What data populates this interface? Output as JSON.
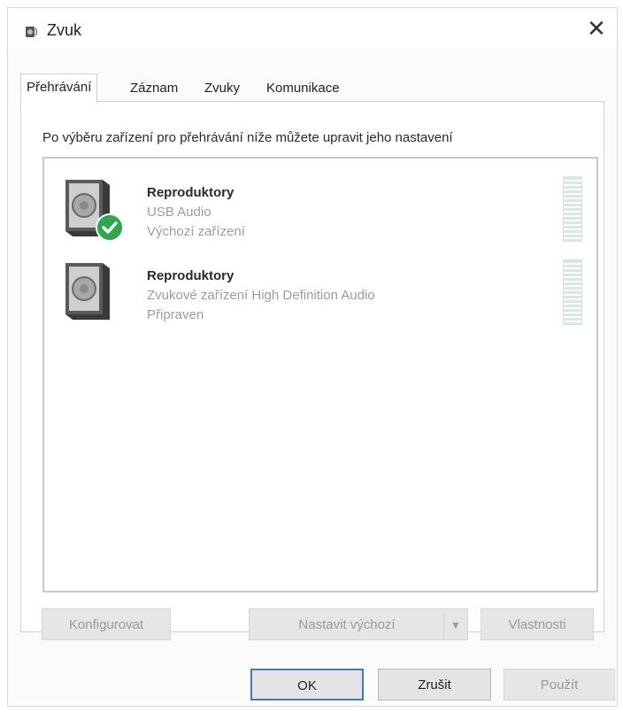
{
  "window": {
    "title": "Zvuk"
  },
  "tabs": [
    {
      "label": "Přehrávání",
      "active": true
    },
    {
      "label": "Záznam",
      "active": false
    },
    {
      "label": "Zvuky",
      "active": false
    },
    {
      "label": "Komunikace",
      "active": false
    }
  ],
  "panel": {
    "instruction": "Po výběru zařízení pro přehrávání níže můžete upravit jeho nastavení",
    "devices": [
      {
        "name": "Reproduktory",
        "description": "USB Audio",
        "status": "Výchozí zařízení",
        "is_default": true
      },
      {
        "name": "Reproduktory",
        "description": "Zvukové zařízení High Definition Audio",
        "status": "Připraven",
        "is_default": false
      }
    ],
    "buttons": {
      "configure": "Konfigurovat",
      "set_default": "Nastavit výchozí",
      "properties": "Vlastnosti"
    }
  },
  "footer": {
    "ok": "OK",
    "cancel": "Zrušit",
    "apply": "Použít"
  },
  "colors": {
    "accent": "#3b7bd4",
    "check_green": "#2ea84a"
  },
  "icons": {
    "title": "speaker-icon",
    "default_badge": "checkmark-icon"
  }
}
